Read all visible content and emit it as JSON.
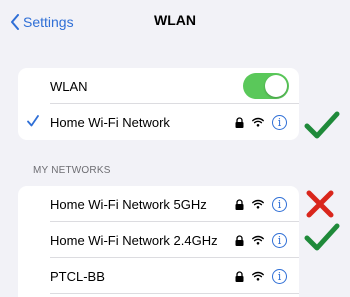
{
  "nav": {
    "back_label": "Settings",
    "title": "WLAN"
  },
  "wlan_card": {
    "wlan_label": "WLAN",
    "toggle_on": true,
    "connected_network": "Home Wi-Fi Network"
  },
  "my_networks": {
    "header": "MY NETWORKS",
    "items": [
      {
        "name": "Home Wi-Fi Network 5GHz",
        "marker": "red-x"
      },
      {
        "name": "Home Wi-Fi Network 2.4GHz",
        "marker": "green-check"
      },
      {
        "name": "PTCL-BB",
        "marker": ""
      }
    ]
  },
  "colors": {
    "accent": "#2f6fd6",
    "toggle_on": "#5ac85a",
    "check_green": "#1f8a3a",
    "x_red": "#d9261c"
  }
}
